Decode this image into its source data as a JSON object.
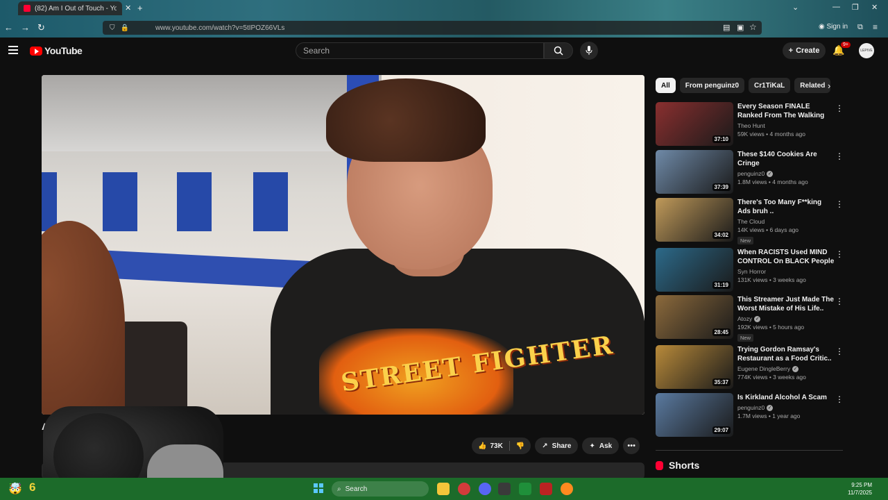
{
  "browser": {
    "tab_title": "(82) Am I Out of Touch - Yo",
    "url": "www.youtube.com/watch?v=5tIPOZ66VLs",
    "signin_label": "Sign in"
  },
  "header": {
    "logo_text": "YouTube",
    "search_placeholder": "Search",
    "create_label": "Create",
    "notif_count": "9+",
    "avatar_text": "LEPIVE"
  },
  "video": {
    "title_visible": "Am",
    "shirt_text": "STREET FIGHTER"
  },
  "actions": {
    "like_count": "73K",
    "share_label": "Share",
    "ask_label": "Ask"
  },
  "sidebar": {
    "chips": [
      "All",
      "From penguinz0",
      "Cr1TiKaL",
      "Related"
    ],
    "recommendations": [
      {
        "title": "Every Season FINALE Ranked From The Walking Dead",
        "channel": "Theo Hunt",
        "verified": false,
        "meta": "59K views • 4 months ago",
        "duration": "37:10",
        "badge": "",
        "thumb_color": "#8a2f2f"
      },
      {
        "title": "These $140 Cookies Are Cringe",
        "channel": "penguinz0",
        "verified": true,
        "meta": "1.8M views • 4 months ago",
        "duration": "37:39",
        "badge": "",
        "thumb_color": "#6f8aa8"
      },
      {
        "title": "There's Too Many F**king Ads bruh ..",
        "channel": "The Cloud",
        "verified": false,
        "meta": "14K views • 6 days ago",
        "duration": "34:02",
        "badge": "New",
        "thumb_color": "#c09a5a"
      },
      {
        "title": "When RACISTS Used MIND CONTROL On BLACK People",
        "channel": "Syn Horror",
        "verified": false,
        "meta": "131K views • 3 weeks ago",
        "duration": "31:19",
        "badge": "",
        "thumb_color": "#2c6a8a"
      },
      {
        "title": "This Streamer Just Made The Worst Mistake of His Life..",
        "channel": "Atozy",
        "verified": true,
        "meta": "192K views • 5 hours ago",
        "duration": "28:45",
        "badge": "New",
        "thumb_color": "#8c6a3c"
      },
      {
        "title": "Trying Gordon Ramsay's Restaurant as a Food Critic..",
        "channel": "Eugene DingleBerry",
        "verified": true,
        "meta": "774K views • 3 weeks ago",
        "duration": "35:37",
        "badge": "",
        "thumb_color": "#b88a3a"
      },
      {
        "title": "Is Kirkland Alcohol A Scam",
        "channel": "penguinz0",
        "verified": true,
        "meta": "1.7M views • 1 year ago",
        "duration": "29:07",
        "badge": "",
        "thumb_color": "#5a7aa0"
      }
    ],
    "shorts_label": "Shorts"
  },
  "taskbar": {
    "search_label": "Search",
    "time": "9:25 PM",
    "date": "11/7/2025",
    "left_badge": "6"
  }
}
